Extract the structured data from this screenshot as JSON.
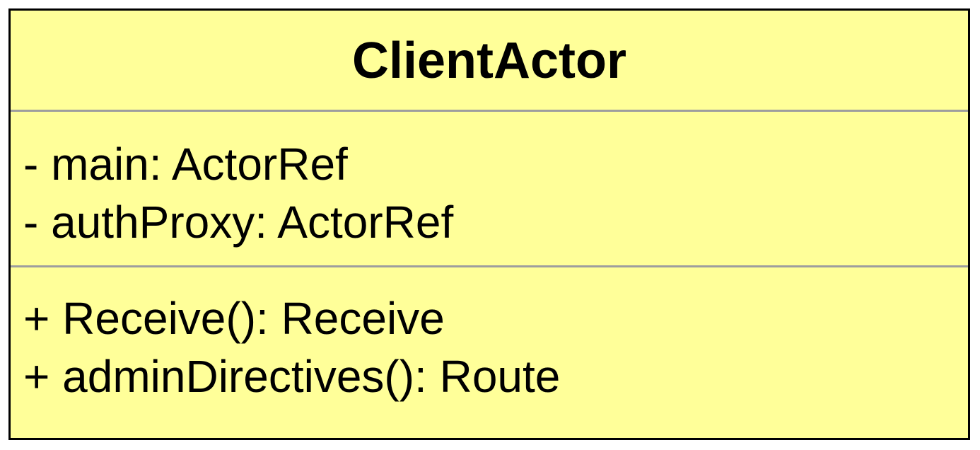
{
  "class": {
    "name": "ClientActor",
    "attributes": [
      "- main: ActorRef",
      "- authProxy: ActorRef"
    ],
    "operations": [
      "+ Receive(): Receive",
      "+ adminDirectives(): Route"
    ]
  },
  "colors": {
    "fill": "#ffff99",
    "border": "#000000",
    "divider": "#9e9e9e"
  }
}
